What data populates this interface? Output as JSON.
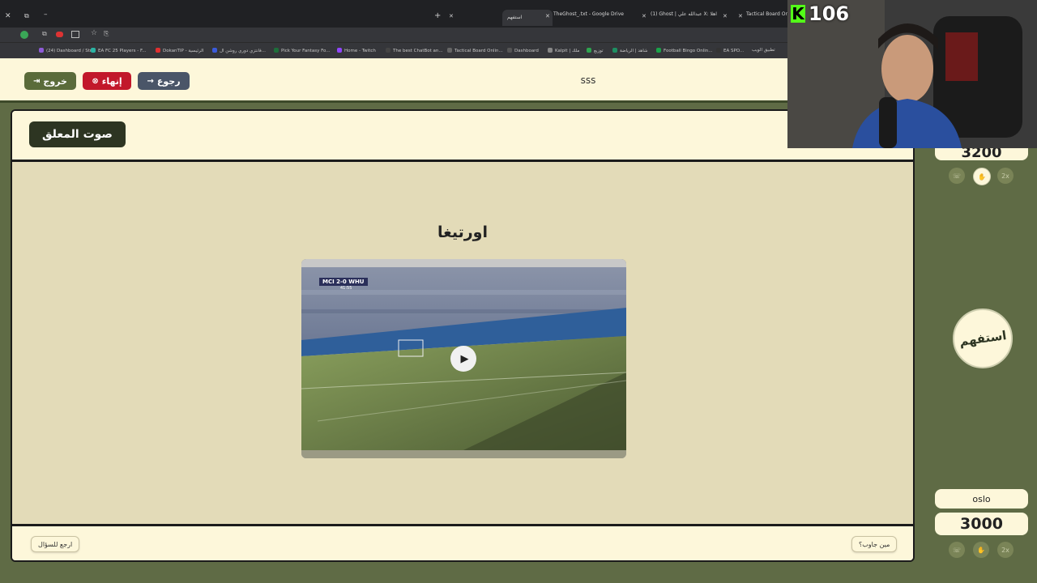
{
  "browser": {
    "tabs": [
      {
        "label": "استفهم",
        "active": true
      },
      {
        "label": "TheGhost_.txt - Google Drive"
      },
      {
        "label": "(1) Ghost | عبدالله علي X: اهلا ."
      },
      {
        "label": "Tactical Board Onli..."
      }
    ],
    "bookmarks": [
      {
        "label": "(24) Dashboard / Str...",
        "color": "#8e5bd8"
      },
      {
        "label": "EA FC 25 Players - F...",
        "color": "#2bb3a3"
      },
      {
        "label": "DokanTIP - الرئيسية",
        "color": "#e03030"
      },
      {
        "label": "فانتزي دوري روشن ال...",
        "color": "#3b5bdb"
      },
      {
        "label": "Pick Your Fantasy Fo...",
        "color": "#1d6e3a"
      },
      {
        "label": "Home - Twitch",
        "color": "#9146ff"
      },
      {
        "label": "The best ChatBot an...",
        "color": "#444444"
      },
      {
        "label": "Tactical Board Onlin...",
        "color": "#666666"
      },
      {
        "label": "Dashboard",
        "color": "#555555"
      },
      {
        "label": "Kalpit | ملك",
        "color": "#888888"
      },
      {
        "label": "توزيع",
        "color": "#2ea44f"
      },
      {
        "label": "شاهد | الرياضة",
        "color": "#1d8f62"
      },
      {
        "label": "Football Bingo Onlin...",
        "color": "#1aa34a"
      },
      {
        "label": "EA SPO...",
        "color": "#333333"
      },
      {
        "label": "تطبيق الويب",
        "color": "#444444"
      }
    ]
  },
  "header": {
    "team_name": "sss",
    "exit_label": "خروج",
    "end_label": "إنهاء",
    "back_label": "رجوع",
    "colors": {
      "exit": "#5a6b3a",
      "end": "#c2182b",
      "back": "#4a5568"
    }
  },
  "card": {
    "category": "صوت المعلق",
    "answer": "اورتيغا",
    "video": {
      "score_text": "MCI 2-0 WHU",
      "clock": "41:55"
    },
    "back_to_question": "ارجع للسؤال",
    "who_answered": "مين جاوب؟"
  },
  "right_panel": {
    "team1_score": "3200",
    "team2_name": "oslo",
    "team2_score": "3000",
    "logo_text": "استفهم",
    "double_label": "2x"
  },
  "stream": {
    "kick_viewers": "106",
    "brand_color": "#53fc18"
  }
}
